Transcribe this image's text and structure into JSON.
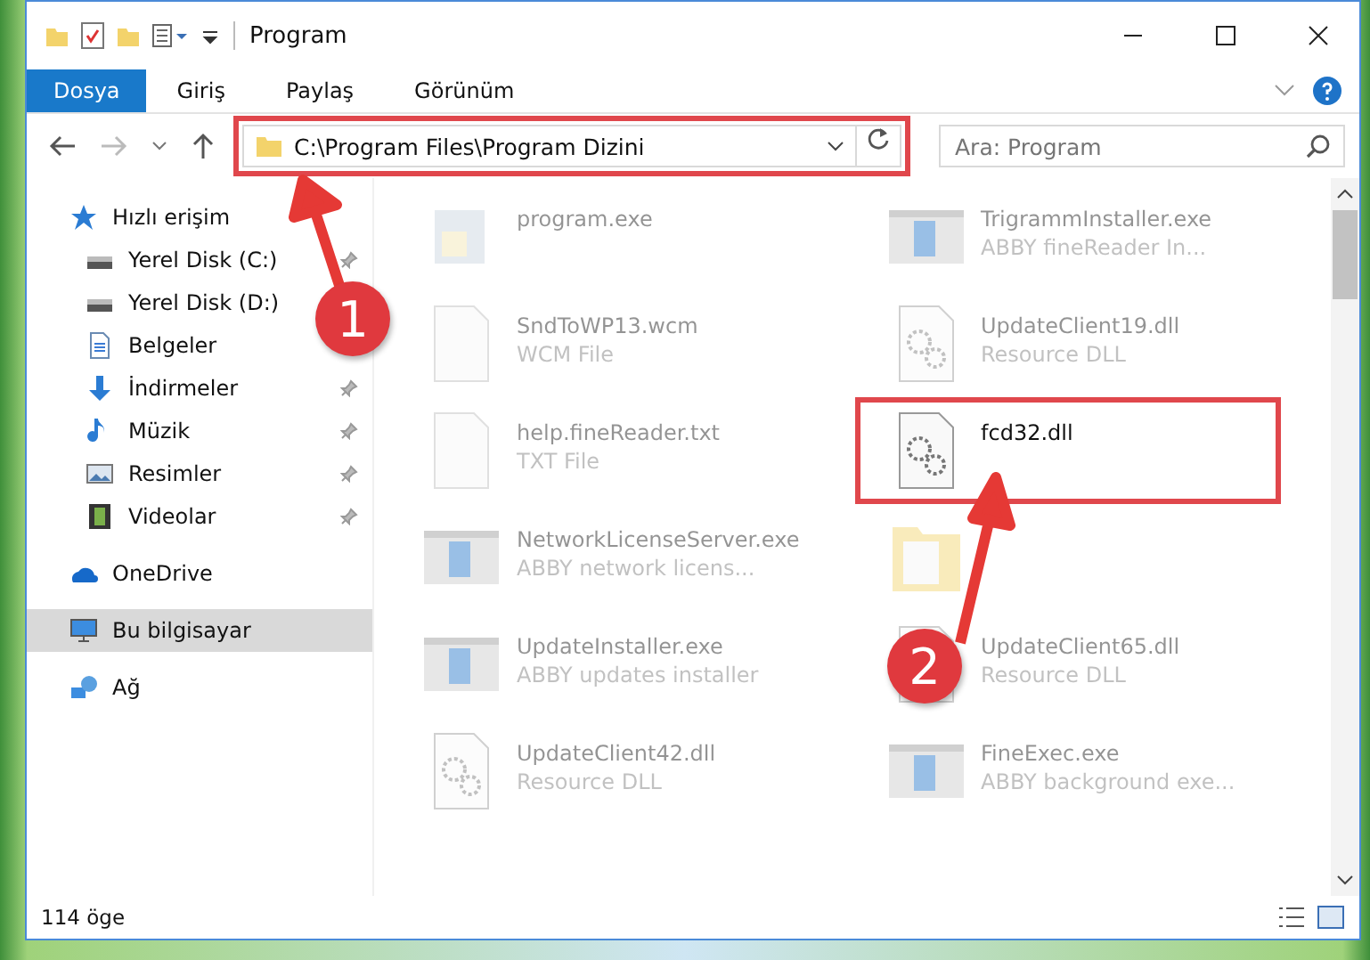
{
  "window": {
    "title": "Program"
  },
  "ribbon_tabs": [
    {
      "label": "Dosya",
      "selected": true
    },
    {
      "label": "Giriş",
      "selected": false
    },
    {
      "label": "Paylaş",
      "selected": false
    },
    {
      "label": "Görünüm",
      "selected": false
    }
  ],
  "address": {
    "path": "C:\\Program Files\\Program Dizini"
  },
  "search": {
    "placeholder": "Ara: Program"
  },
  "sidebar": {
    "items": [
      {
        "label": "Hızlı erişim",
        "kind": "star",
        "pinned": false,
        "selected": false,
        "nested": false
      },
      {
        "label": "Yerel Disk (C:)",
        "kind": "disk",
        "pinned": true,
        "selected": false,
        "nested": true
      },
      {
        "label": "Yerel Disk (D:)",
        "kind": "disk",
        "pinned": false,
        "selected": false,
        "nested": true
      },
      {
        "label": "Belgeler",
        "kind": "doc",
        "pinned": false,
        "selected": false,
        "nested": true
      },
      {
        "label": "İndirmeler",
        "kind": "download",
        "pinned": true,
        "selected": false,
        "nested": true
      },
      {
        "label": "Müzik",
        "kind": "music",
        "pinned": true,
        "selected": false,
        "nested": true
      },
      {
        "label": "Resimler",
        "kind": "pictures",
        "pinned": true,
        "selected": false,
        "nested": true
      },
      {
        "label": "Videolar",
        "kind": "video",
        "pinned": true,
        "selected": false,
        "nested": true
      },
      {
        "label": "OneDrive",
        "kind": "cloud",
        "pinned": false,
        "selected": false,
        "nested": false
      },
      {
        "label": "Bu bilgisayar",
        "kind": "pc",
        "pinned": false,
        "selected": true,
        "nested": false
      },
      {
        "label": "Ağ",
        "kind": "network",
        "pinned": false,
        "selected": false,
        "nested": false
      }
    ]
  },
  "files": [
    {
      "name": "program.exe",
      "kind": "app",
      "faded": true
    },
    {
      "name": "TrigrammInstaller.exe",
      "type": "ABBY fineReader In...",
      "kind": "exe",
      "faded": true
    },
    {
      "name": "SndToWP13.wcm",
      "type": "WCM File",
      "kind": "blank",
      "faded": true
    },
    {
      "name": "UpdateClient19.dll",
      "type": "Resource DLL",
      "kind": "dll",
      "faded": true
    },
    {
      "name": "help.fineReader.txt",
      "type": "TXT File",
      "kind": "blank",
      "faded": true
    },
    {
      "name": "fcd32.dll",
      "kind": "dll",
      "faded": false
    },
    {
      "name": "NetworkLicenseServer.exe",
      "type": "ABBY network licens...",
      "kind": "exe",
      "faded": true
    },
    {
      "kind": "folder",
      "faded": true
    },
    {
      "name": "UpdateInstaller.exe",
      "type": "ABBY updates installer",
      "kind": "exe",
      "faded": true
    },
    {
      "name": "UpdateClient65.dll",
      "type": "Resource DLL",
      "kind": "dll",
      "faded": true
    },
    {
      "name": "UpdateClient42.dll",
      "type": "Resource DLL",
      "kind": "dll",
      "faded": true
    },
    {
      "name": "FineExec.exe",
      "type": "ABBY background exe...",
      "kind": "exe",
      "faded": true
    }
  ],
  "status_bar": {
    "count": "114 öge"
  },
  "callouts": [
    "1",
    "2"
  ]
}
